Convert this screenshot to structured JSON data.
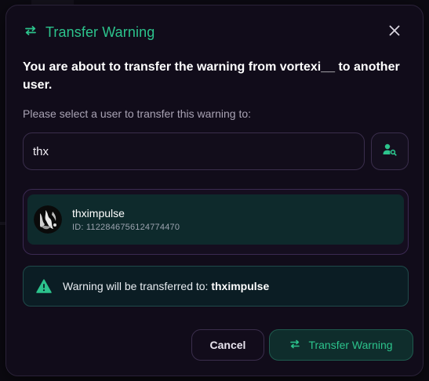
{
  "modal": {
    "title": "Transfer Warning",
    "title_icon": "transfer-arrows-icon",
    "close_icon": "close-icon",
    "description_prefix": "You are about to transfer the warning from",
    "description_user": "vortexi__",
    "description_suffix": "to another user.",
    "prompt": "Please select a user to transfer this warning to:"
  },
  "search": {
    "value": "thx",
    "button_icon": "user-search-icon"
  },
  "results": [
    {
      "name": "thximpulse",
      "id_label": "ID:",
      "id": "1122846756124774470",
      "avatar_icon": "avatar-image"
    }
  ],
  "alert": {
    "icon": "warning-triangle-icon",
    "text": "Warning will be transferred to:",
    "target": "thximpulse"
  },
  "actions": {
    "cancel_label": "Cancel",
    "transfer_label": "Transfer Warning",
    "transfer_icon": "transfer-arrows-icon"
  },
  "colors": {
    "accent": "#2cc38c",
    "modal_bg": "#110c1a",
    "selected_bg": "#0e2a2c"
  }
}
